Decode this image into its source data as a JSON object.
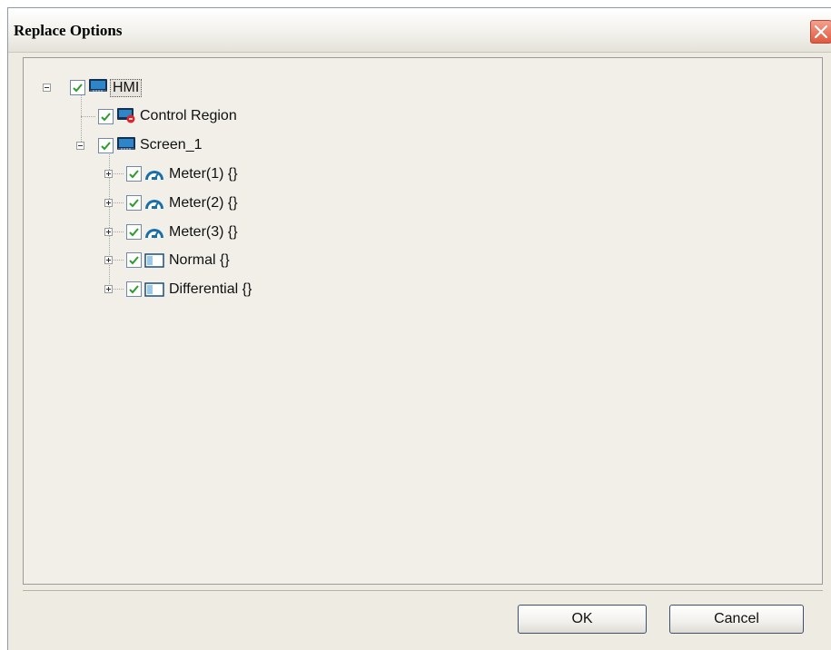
{
  "dialog": {
    "title": "Replace Options",
    "close_icon": "close-icon",
    "ok_label": "OK",
    "cancel_label": "Cancel"
  },
  "tree": {
    "root": {
      "label": "HMI",
      "checked": true,
      "expanded": true,
      "icon": "hmi-monitor-icon"
    },
    "control_region": {
      "label": "Control Region",
      "checked": true,
      "icon": "control-region-icon"
    },
    "screen": {
      "label": "Screen_1",
      "checked": true,
      "expanded": true,
      "icon": "screen-icon"
    },
    "children": [
      {
        "label": "Meter(1) {}",
        "checked": true,
        "expanded": false,
        "icon": "meter-icon"
      },
      {
        "label": "Meter(2) {}",
        "checked": true,
        "expanded": false,
        "icon": "meter-icon"
      },
      {
        "label": "Meter(3) {}",
        "checked": true,
        "expanded": false,
        "icon": "meter-icon"
      },
      {
        "label": "Normal {}",
        "checked": true,
        "expanded": false,
        "icon": "display-box-icon"
      },
      {
        "label": "Differential {}",
        "checked": true,
        "expanded": false,
        "icon": "display-box-icon"
      }
    ]
  },
  "colors": {
    "check": "#2a9d2a",
    "icon_blue": "#1b6fa8",
    "panel_bg": "#f1efe8",
    "close_red": "#e0583f"
  }
}
